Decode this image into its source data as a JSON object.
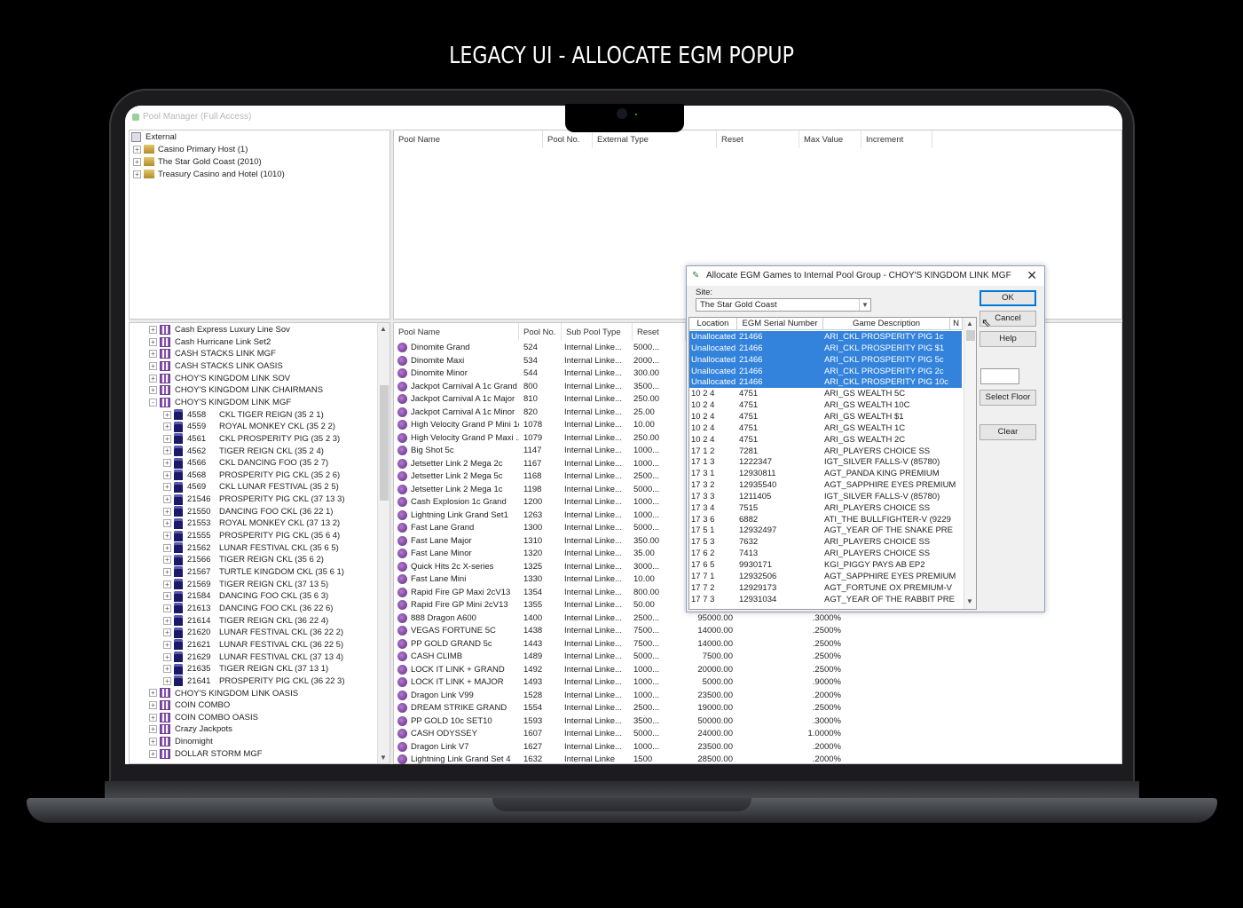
{
  "page": {
    "headline": "LEGACY UI - ALLOCATE EGM POPUP"
  },
  "app": {
    "title": "Pool Manager (Full Access)"
  },
  "tree_top": {
    "root": "External",
    "items": [
      "Casino Primary Host (1)",
      "The Star Gold Coast (2010)",
      "Treasury Casino and Hotel (1010)"
    ]
  },
  "top_grid": {
    "columns": [
      "Pool Name",
      "Pool No.",
      "External Type",
      "Reset",
      "Max Value",
      "Increment"
    ]
  },
  "tree_bottom": {
    "groups_before": [
      "Cash Express Luxury Line Sov",
      "Cash Hurricane Link Set2",
      "CASH STACKS LINK MGF",
      "CASH STACKS LINK OASIS",
      "CHOY'S  KINGDOM LINK SOV",
      "CHOY'S KINGDOM LINK CHAIRMANS"
    ],
    "expanded_group": "CHOY'S KINGDOM LINK MGF",
    "machines": [
      {
        "id": "4558",
        "name": "CKL TIGER REIGN (35 2 1)"
      },
      {
        "id": "4559",
        "name": "ROYAL MONKEY CKL (35 2 2)"
      },
      {
        "id": "4561",
        "name": "CKL PROSPERITY PIG (35 2 3)"
      },
      {
        "id": "4562",
        "name": "TIGER REIGN CKL (35 2 4)"
      },
      {
        "id": "4566",
        "name": "CKL DANCING FOO (35 2 7)"
      },
      {
        "id": "4568",
        "name": "PROSPERITY PIG CKL (35 2 6)"
      },
      {
        "id": "4569",
        "name": "CKL LUNAR FESTIVAL (35 2 5)"
      },
      {
        "id": "21546",
        "name": "PROSPERITY PIG CKL (37 13 3)"
      },
      {
        "id": "21550",
        "name": "DANCING FOO CKL (36 22 1)"
      },
      {
        "id": "21553",
        "name": "ROYAL MONKEY CKL (37 13 2)"
      },
      {
        "id": "21555",
        "name": "PROSPERITY PIG CKL (35 6 4)"
      },
      {
        "id": "21562",
        "name": "LUNAR FESTIVAL CKL (35 6 5)"
      },
      {
        "id": "21566",
        "name": "TIGER REIGN CKL (35 6 2)"
      },
      {
        "id": "21567",
        "name": "TURTLE KINGDOM CKL (35 6 1)"
      },
      {
        "id": "21569",
        "name": "TIGER REIGN CKL (37 13 5)"
      },
      {
        "id": "21584",
        "name": "DANCING FOO CKL (35 6 3)"
      },
      {
        "id": "21613",
        "name": "DANCING FOO CKL (36 22 6)"
      },
      {
        "id": "21614",
        "name": "TIGER REIGN CKL (36 22 4)"
      },
      {
        "id": "21620",
        "name": "LUNAR FESTIVAL CKL (36 22 2)"
      },
      {
        "id": "21621",
        "name": "LUNAR FESTIVAL CKL (36 22 5)"
      },
      {
        "id": "21629",
        "name": "LUNAR FESTIVAL CKL (37 13 4)"
      },
      {
        "id": "21635",
        "name": "TIGER REIGN CKL (37 13 1)"
      },
      {
        "id": "21641",
        "name": "PROSPERITY PIG CKL (36 22 3)"
      }
    ],
    "groups_after": [
      "CHOY'S KINGDOM LINK OASIS",
      "COIN COMBO",
      "COIN COMBO OASIS",
      "Crazy Jackpots",
      "Dinomight",
      "DOLLAR STORM MGF"
    ]
  },
  "bottom_grid": {
    "columns": [
      "Pool Name",
      "Pool No.",
      "Sub Pool Type",
      "Reset"
    ],
    "rows": [
      {
        "name": "Dinomite Grand",
        "no": "524",
        "type": "Internal Linke...",
        "reset": "5000...",
        "max": "",
        "inc": ""
      },
      {
        "name": "Dinomite Maxi",
        "no": "534",
        "type": "Internal Linke...",
        "reset": "2000...",
        "max": "",
        "inc": ""
      },
      {
        "name": "Dinomite Minor",
        "no": "544",
        "type": "Internal Linke...",
        "reset": "300.00",
        "max": "",
        "inc": ""
      },
      {
        "name": "Jackpot Carnival A 1c Grand",
        "no": "800",
        "type": "Internal Linke...",
        "reset": "3500...",
        "max": "",
        "inc": ""
      },
      {
        "name": "Jackpot Carnival A 1c Major",
        "no": "810",
        "type": "Internal Linke...",
        "reset": "250.00",
        "max": "",
        "inc": ""
      },
      {
        "name": "Jackpot Carnival A 1c Minor",
        "no": "820",
        "type": "Internal Linke...",
        "reset": "25.00",
        "max": "",
        "inc": ""
      },
      {
        "name": "High Velocity Grand P Mini 1c",
        "no": "1078",
        "type": "Internal Linke...",
        "reset": "10.00",
        "max": "",
        "inc": ""
      },
      {
        "name": "High Velocity Grand P Maxi ...",
        "no": "1079",
        "type": "Internal Linke...",
        "reset": "250.00",
        "max": "",
        "inc": ""
      },
      {
        "name": "Big Shot 5c",
        "no": "1147",
        "type": "Internal Linke...",
        "reset": "1000...",
        "max": "",
        "inc": ""
      },
      {
        "name": "Jetsetter Link 2 Mega 2c",
        "no": "1167",
        "type": "Internal Linke...",
        "reset": "1000...",
        "max": "",
        "inc": ""
      },
      {
        "name": "Jetsetter Link 2 Mega 5c",
        "no": "1168",
        "type": "Internal Linke...",
        "reset": "2500...",
        "max": "",
        "inc": ""
      },
      {
        "name": "Jetsetter Link 2 Mega 1c",
        "no": "1198",
        "type": "Internal Linke...",
        "reset": "5000...",
        "max": "",
        "inc": ""
      },
      {
        "name": "Cash Explosion 1c Grand",
        "no": "1200",
        "type": "Internal Linke...",
        "reset": "1000...",
        "max": "",
        "inc": ""
      },
      {
        "name": "Lightning Link Grand Set1",
        "no": "1263",
        "type": "Internal Linke...",
        "reset": "1000...",
        "max": "",
        "inc": ""
      },
      {
        "name": "Fast Lane Grand",
        "no": "1300",
        "type": "Internal Linke...",
        "reset": "5000...",
        "max": "",
        "inc": ""
      },
      {
        "name": "Fast Lane Major",
        "no": "1310",
        "type": "Internal Linke...",
        "reset": "350.00",
        "max": "",
        "inc": ""
      },
      {
        "name": "Fast Lane Minor",
        "no": "1320",
        "type": "Internal Linke...",
        "reset": "35.00",
        "max": "",
        "inc": ""
      },
      {
        "name": "Quick Hits 2c X-series",
        "no": "1325",
        "type": "Internal Linke...",
        "reset": "3000...",
        "max": "",
        "inc": ""
      },
      {
        "name": "Fast Lane Mini",
        "no": "1330",
        "type": "Internal Linke...",
        "reset": "10.00",
        "max": "",
        "inc": ""
      },
      {
        "name": "Rapid Fire GP Maxi 2cV13",
        "no": "1354",
        "type": "Internal Linke...",
        "reset": "800.00",
        "max": "",
        "inc": ""
      },
      {
        "name": "Rapid Fire GP Mini 2cV13",
        "no": "1355",
        "type": "Internal Linke...",
        "reset": "50.00",
        "max": "",
        "inc": ""
      },
      {
        "name": "888 Dragon A600",
        "no": "1400",
        "type": "Internal Linke...",
        "reset": "2500...",
        "max": "95000.00",
        "inc": ".3000%"
      },
      {
        "name": "VEGAS FORTUNE 5C",
        "no": "1438",
        "type": "Internal Linke...",
        "reset": "7500...",
        "max": "14000.00",
        "inc": ".2500%"
      },
      {
        "name": "PP GOLD GRAND 5c",
        "no": "1443",
        "type": "Internal Linke...",
        "reset": "7500...",
        "max": "14000.00",
        "inc": ".2500%"
      },
      {
        "name": "CASH CLIMB",
        "no": "1489",
        "type": "Internal Linke...",
        "reset": "5000...",
        "max": "7500.00",
        "inc": ".2500%"
      },
      {
        "name": "LOCK IT LINK + GRAND",
        "no": "1492",
        "type": "Internal Linke...",
        "reset": "1000...",
        "max": "20000.00",
        "inc": ".2500%"
      },
      {
        "name": "LOCK IT LINK + MAJOR",
        "no": "1493",
        "type": "Internal Linke...",
        "reset": "1000...",
        "max": "5000.00",
        "inc": ".9000%"
      },
      {
        "name": "Dragon Link V99",
        "no": "1528",
        "type": "Internal Linke...",
        "reset": "1000...",
        "max": "23500.00",
        "inc": ".2000%"
      },
      {
        "name": "DREAM STRIKE GRAND",
        "no": "1554",
        "type": "Internal Linke...",
        "reset": "2500...",
        "max": "19000.00",
        "inc": ".2500%"
      },
      {
        "name": "PP GOLD 10c SET10",
        "no": "1593",
        "type": "Internal Linke...",
        "reset": "3500...",
        "max": "50000.00",
        "inc": ".3000%"
      },
      {
        "name": "CASH ODYSSEY",
        "no": "1607",
        "type": "Internal Linke...",
        "reset": "5000...",
        "max": "24000.00",
        "inc": "1.0000%"
      },
      {
        "name": "Dragon Link V7",
        "no": "1627",
        "type": "Internal Linke...",
        "reset": "1000...",
        "max": "23500.00",
        "inc": ".2000%"
      },
      {
        "name": "Lightning Link Grand Set 4",
        "no": "1632",
        "type": "Internal Linke",
        "reset": "1500",
        "max": "28500.00",
        "inc": ".2000%"
      }
    ]
  },
  "dialog": {
    "title": "Allocate EGM Games to Internal Pool Group - CHOY'S KINGDOM LINK MGF",
    "site_label": "Site:",
    "site_value": "The Star Gold Coast",
    "columns": [
      "Location",
      "EGM Serial Number",
      "Game Description",
      "N"
    ],
    "rows": [
      {
        "loc": "Unallocated",
        "serial": "21466",
        "game": "ARI_CKL PROSPERITY PIG 1c",
        "selected": true
      },
      {
        "loc": "Unallocated",
        "serial": "21466",
        "game": "ARI_CKL PROSPERITY PIG $1",
        "selected": true
      },
      {
        "loc": "Unallocated",
        "serial": "21466",
        "game": "ARI_CKL PROSPERITY PIG 5c",
        "selected": true
      },
      {
        "loc": "Unallocated",
        "serial": "21466",
        "game": "ARI_CKL PROSPERITY PIG 2c",
        "selected": true
      },
      {
        "loc": "Unallocated",
        "serial": "21466",
        "game": "ARI_CKL PROSPERITY PIG 10c",
        "selected": true
      },
      {
        "loc": "10 2 4",
        "serial": "4751",
        "game": "ARI_GS WEALTH 5C",
        "selected": false
      },
      {
        "loc": "10 2 4",
        "serial": "4751",
        "game": "ARI_GS WEALTH 10C",
        "selected": false
      },
      {
        "loc": "10 2 4",
        "serial": "4751",
        "game": "ARI_GS WEALTH $1",
        "selected": false
      },
      {
        "loc": "10 2 4",
        "serial": "4751",
        "game": "ARI_GS WEALTH 1C",
        "selected": false
      },
      {
        "loc": "10 2 4",
        "serial": "4751",
        "game": "ARI_GS WEALTH 2C",
        "selected": false
      },
      {
        "loc": "17 1 2",
        "serial": "7281",
        "game": "ARI_PLAYERS CHOICE SS",
        "selected": false
      },
      {
        "loc": "17 1 3",
        "serial": "1222347",
        "game": "IGT_SILVER FALLS-V (85780)",
        "selected": false
      },
      {
        "loc": "17 3 1",
        "serial": "12930811",
        "game": "AGT_PANDA KING PREMIUM",
        "selected": false
      },
      {
        "loc": "17 3 2",
        "serial": "12935540",
        "game": "AGT_SAPPHIRE EYES PREMIUM",
        "selected": false
      },
      {
        "loc": "17 3 3",
        "serial": "1211405",
        "game": "IGT_SILVER FALLS-V (85780)",
        "selected": false
      },
      {
        "loc": "17 3 4",
        "serial": "7515",
        "game": "ARI_PLAYERS CHOICE SS",
        "selected": false
      },
      {
        "loc": "17 3 6",
        "serial": "6882",
        "game": "ATI_THE BULLFIGHTER-V (9229",
        "selected": false
      },
      {
        "loc": "17 5 1",
        "serial": "12932497",
        "game": "AGT_YEAR OF THE SNAKE PRE",
        "selected": false
      },
      {
        "loc": "17 5 3",
        "serial": "7632",
        "game": "ARI_PLAYERS CHOICE SS",
        "selected": false
      },
      {
        "loc": "17 6 2",
        "serial": "7413",
        "game": "ARI_PLAYERS CHOICE SS",
        "selected": false
      },
      {
        "loc": "17 6 5",
        "serial": "9930171",
        "game": "KGI_PIGGY PAYS AB EP2",
        "selected": false
      },
      {
        "loc": "17 7 1",
        "serial": "12932506",
        "game": "AGT_SAPPHIRE EYES PREMIUM",
        "selected": false
      },
      {
        "loc": "17 7 2",
        "serial": "12929173",
        "game": "AGT_FORTUNE OX PREMIUM-V",
        "selected": false
      },
      {
        "loc": "17 7 3",
        "serial": "12931034",
        "game": "AGT_YEAR OF THE RABBIT PRE",
        "selected": false
      }
    ],
    "buttons": {
      "ok": "OK",
      "cancel": "Cancel",
      "help": "Help",
      "select_floor": "Select Floor",
      "clear": "Clear"
    }
  }
}
